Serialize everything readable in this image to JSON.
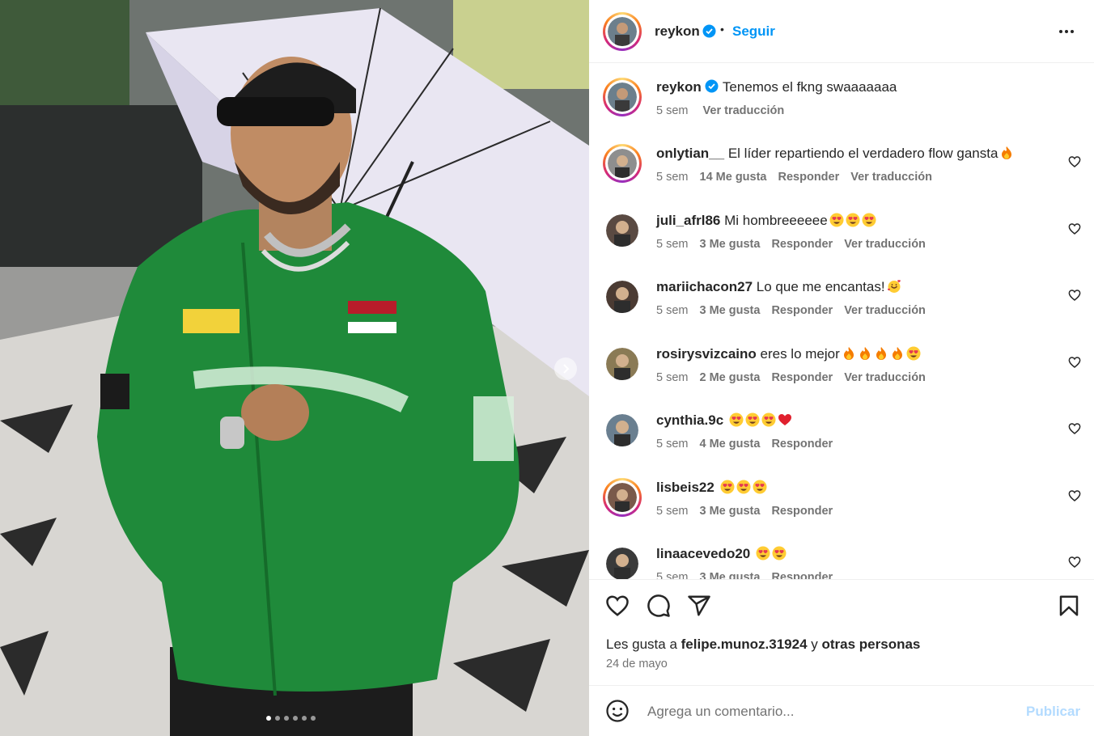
{
  "post": {
    "username": "reykon",
    "follow_label": "Seguir",
    "separator": "•",
    "caption": "Tenemos el fkng swaaaaaaa",
    "caption_age": "5 sem",
    "caption_translate": "Ver traducción",
    "carousel_count": 6,
    "carousel_active": 0
  },
  "comments": [
    {
      "user": "onlytian__",
      "text": "El líder repartiendo el verdadero flow gansta",
      "emojis": [
        "fire-emoji"
      ],
      "age": "5 sem",
      "likes": "14 Me gusta",
      "reply": "Responder",
      "translate": "Ver traducción",
      "story_ring": true
    },
    {
      "user": "juli_afrl86",
      "text": "Mi hombreeeeee",
      "emojis": [
        "heart-eyes-emoji",
        "heart-eyes-emoji",
        "heart-eyes-emoji"
      ],
      "age": "5 sem",
      "likes": "3 Me gusta",
      "reply": "Responder",
      "translate": "Ver traducción",
      "story_ring": false
    },
    {
      "user": "mariichacon27",
      "text": "Lo que me encantas!",
      "emojis": [
        "smiling-hearts-emoji"
      ],
      "age": "5 sem",
      "likes": "3 Me gusta",
      "reply": "Responder",
      "translate": "Ver traducción",
      "story_ring": false
    },
    {
      "user": "rosirysvizcaino",
      "text": "eres lo mejor",
      "emojis": [
        "fire-emoji",
        "fire-emoji",
        "fire-emoji",
        "fire-emoji",
        "heart-eyes-emoji"
      ],
      "age": "5 sem",
      "likes": "2 Me gusta",
      "reply": "Responder",
      "translate": "Ver traducción",
      "story_ring": false
    },
    {
      "user": "cynthia.9c",
      "text": "",
      "emojis": [
        "heart-eyes-emoji",
        "heart-eyes-emoji",
        "heart-eyes-emoji",
        "red-heart-emoji"
      ],
      "age": "5 sem",
      "likes": "4 Me gusta",
      "reply": "Responder",
      "translate": "",
      "story_ring": false
    },
    {
      "user": "lisbeis22",
      "text": "",
      "emojis": [
        "heart-eyes-emoji",
        "heart-eyes-emoji",
        "heart-eyes-emoji"
      ],
      "age": "5 sem",
      "likes": "3 Me gusta",
      "reply": "Responder",
      "translate": "",
      "story_ring": true
    },
    {
      "user": "linaacevedo20",
      "text": "",
      "emojis": [
        "heart-eyes-emoji",
        "heart-eyes-emoji"
      ],
      "age": "5 sem",
      "likes": "3 Me gusta",
      "reply": "Responder",
      "translate": "",
      "story_ring": false
    }
  ],
  "likes_line": {
    "prefix": "Les gusta a",
    "user": "felipe.munoz.31924",
    "joiner": "y",
    "others": "otras personas"
  },
  "date": "24 de mayo",
  "composer": {
    "placeholder": "Agrega un comentario...",
    "publish_label": "Publicar"
  },
  "colors": {
    "accent": "#0095f6",
    "publish_disabled": "#b3dbff",
    "jacket": "#1f8a3a"
  }
}
